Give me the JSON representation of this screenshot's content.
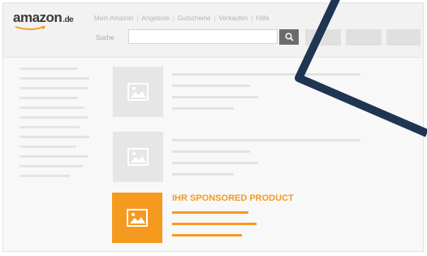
{
  "header": {
    "logo": "amazon",
    "logo_tld": ".de",
    "nav": [
      "Mein Amazon",
      "Angebote",
      "Gutscheine",
      "Verkaufen",
      "Hilfe"
    ],
    "search_label": "Suche"
  },
  "sponsored": {
    "title": "IHR SPONSORED PRODUCT"
  },
  "icons": {
    "search": "search-icon",
    "image": "image-placeholder-icon"
  },
  "colors": {
    "accent": "#f59a1f",
    "overlay_stroke": "#1f3552",
    "placeholder": "#e4e4e4"
  }
}
